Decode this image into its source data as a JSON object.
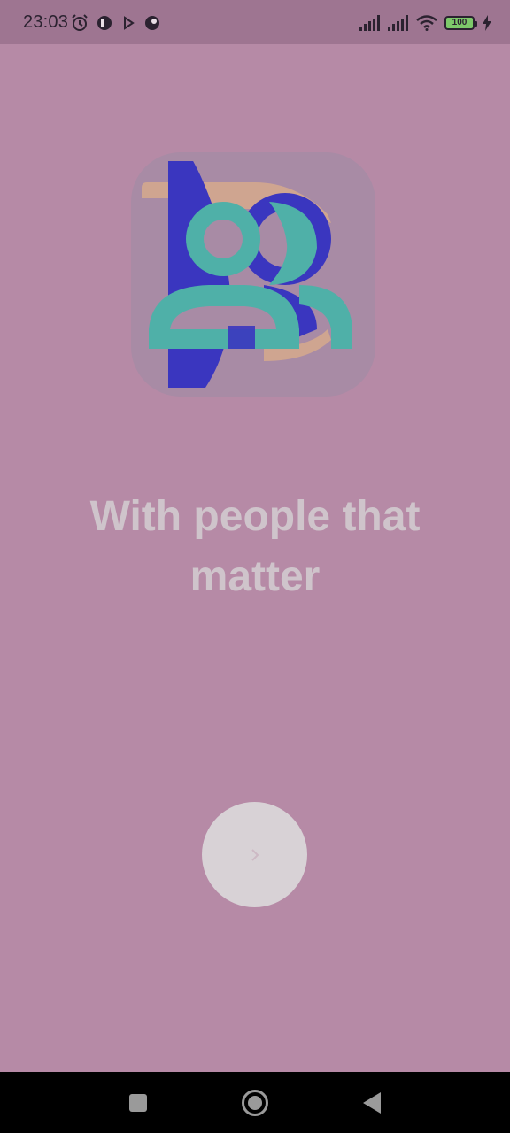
{
  "status_bar": {
    "time": "23:03",
    "battery_level": "100",
    "left_icons": [
      "alarm-icon",
      "app-notification-icon",
      "play-icon",
      "app-notification-icon"
    ],
    "right_icons": [
      "signal-icon",
      "signal-icon",
      "wifi-icon",
      "battery-icon",
      "charging-icon"
    ]
  },
  "onboarding": {
    "tagline_line1": "With people that",
    "tagline_line2": "matter",
    "next_button_icon": "chevron-right-icon"
  },
  "colors": {
    "background": "#b68aa6",
    "logo_blue": "#3a36bf",
    "logo_teal": "#4fb0a8",
    "logo_peach": "#d6a98c",
    "button": "#d8d2d6",
    "tagline": "#cfc4cb"
  },
  "nav_bar": {
    "buttons": [
      "recents-icon",
      "home-icon",
      "back-icon"
    ]
  }
}
